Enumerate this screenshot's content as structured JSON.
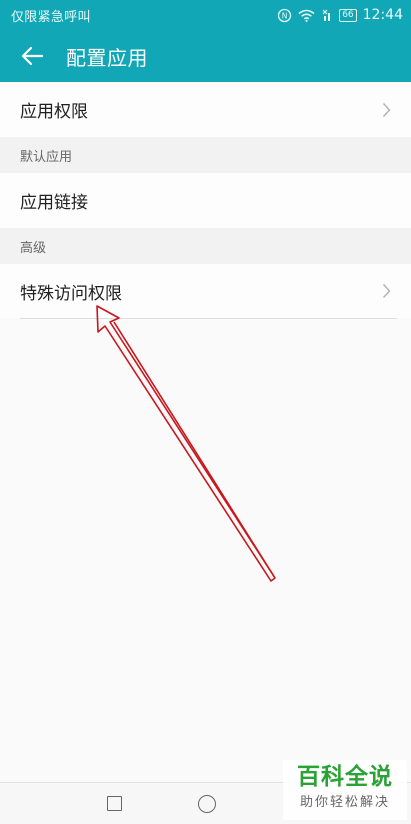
{
  "status_bar": {
    "carrier_text": "仅限紧急呼叫",
    "battery_level": "66",
    "time": "12:44",
    "icons": [
      "nfc-icon",
      "wifi-icon",
      "signal-off-icon",
      "battery-icon"
    ]
  },
  "app_bar": {
    "title": "配置应用",
    "back_icon": "arrow-left-icon"
  },
  "settings": {
    "app_permissions": {
      "label": "应用权限",
      "icon": "chevron-right-icon"
    },
    "default_apps_header": "默认应用",
    "app_links": {
      "label": "应用链接"
    },
    "advanced_header": "高级",
    "special_access": {
      "label": "特殊访问权限",
      "icon": "chevron-right-icon"
    }
  },
  "nav_bar": {
    "buttons": [
      "recents-square-icon",
      "home-circle-icon"
    ]
  },
  "watermark": {
    "title": "百科全说",
    "subtitle": "助你轻松解决"
  },
  "colors": {
    "accent": "#12a7b6",
    "annotation_arrow": "#c8181e",
    "watermark_green": "#2aa235"
  }
}
